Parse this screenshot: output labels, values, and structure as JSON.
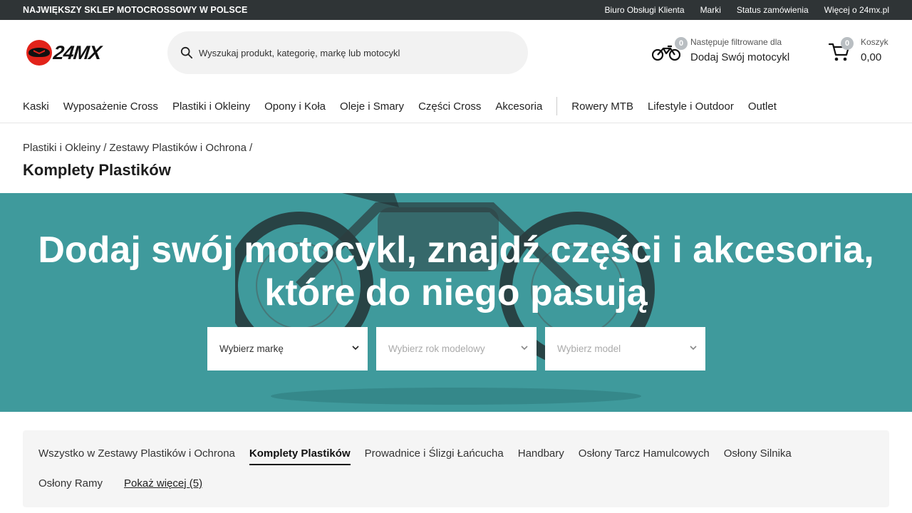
{
  "topbar": {
    "promo": "NAJWIĘKSZY SKLEP MOTOCROSSOWY W POLSCE",
    "links": [
      "Biuro Obsługi Klienta",
      "Marki",
      "Status zamówienia",
      "Więcej o 24mx.pl"
    ]
  },
  "header": {
    "logo_text": "24MX",
    "search_placeholder": "Wyszukaj produkt, kategorię, markę lub motocykl",
    "bike": {
      "badge": "0",
      "label_top": "Następuje filtrowane dla",
      "label_main": "Dodaj Swój motocykl"
    },
    "cart": {
      "badge": "0",
      "label_top": "Koszyk",
      "amount": "0,00"
    }
  },
  "nav": {
    "primary": [
      "Kaski",
      "Wyposażenie Cross",
      "Plastiki i Okleiny",
      "Opony i Koła",
      "Oleje i Smary",
      "Części Cross",
      "Akcesoria"
    ],
    "secondary": [
      "Rowery MTB",
      "Lifestyle i Outdoor",
      "Outlet"
    ]
  },
  "breadcrumb": {
    "items": [
      "Plastiki i Okleiny",
      "Zestawy Plastików i Ochrona"
    ],
    "separator": "/",
    "title": "Komplety Plastików"
  },
  "hero": {
    "heading": "Dodaj swój motocykl, znajdź części i akcesoria, które do niego pasują",
    "bg_color": "#3f9a9c",
    "selects": [
      "Wybierz markę",
      "Wybierz rok modelowy",
      "Wybierz model"
    ]
  },
  "subcategories": {
    "row1": [
      "Wszystko w Zestawy Plastików i Ochrona",
      "Komplety Plastików",
      "Prowadnice i Ślizgi Łańcucha",
      "Handbary",
      "Osłony Tarcz Hamulcowych",
      "Osłony Silnika"
    ],
    "row2": [
      "Osłony Ramy"
    ],
    "active": "Komplety Plastików",
    "more": "Pokaż więcej (5)"
  }
}
